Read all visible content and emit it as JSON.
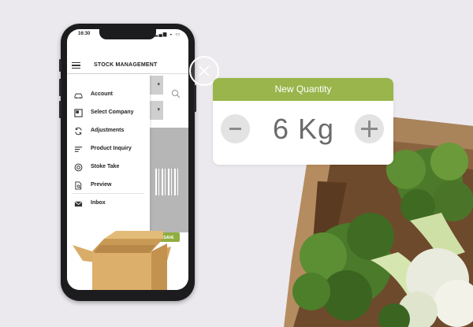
{
  "status_bar": {
    "time": "16:30"
  },
  "app": {
    "title": "STOCK MANAGEMENT",
    "save_label": "SAVE"
  },
  "drawer": {
    "items": [
      {
        "label": "Account",
        "icon": "car-icon"
      },
      {
        "label": "Select Company",
        "icon": "company-icon"
      },
      {
        "label": "Adjustments",
        "icon": "sync-icon"
      },
      {
        "label": "Product Inquiry",
        "icon": "list-icon"
      },
      {
        "label": "Stoke Take",
        "icon": "target-icon"
      },
      {
        "label": "Preview",
        "icon": "document-search-icon"
      },
      {
        "label": "Inbox",
        "icon": "inbox-icon"
      }
    ]
  },
  "quantity_card": {
    "title": "New Quantity",
    "value": "6 Kg",
    "decrement_symbol": "−",
    "increment_symbol": "+"
  },
  "colors": {
    "accent": "#99b54b",
    "save_button": "#8fae3f",
    "background": "#ebe9ed"
  }
}
